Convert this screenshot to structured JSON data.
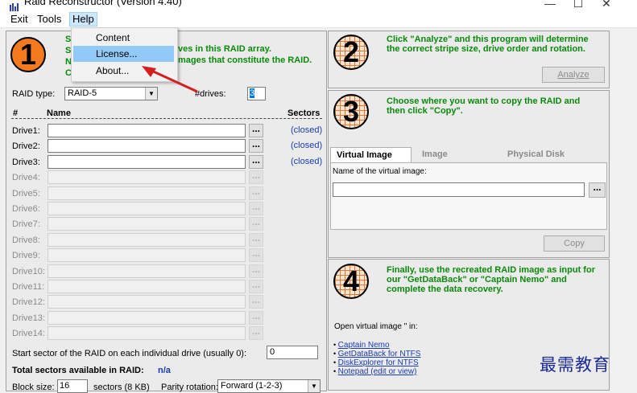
{
  "window": {
    "title": "Raid Reconstructor (Version 4.40)",
    "controls": [
      "—",
      "☐",
      "✕"
    ]
  },
  "menubar": {
    "items": [
      "Exit",
      "Tools",
      "Help"
    ]
  },
  "help_menu": {
    "items": [
      "Content",
      "License...",
      "About..."
    ],
    "highlighted": "License..."
  },
  "step1": {
    "number": "1",
    "line1_visible": "ves in this RAID array.",
    "line2_visible": "mages that constitute the RAID.",
    "left_fragments": [
      "S",
      "S",
      "N",
      "C"
    ],
    "raid_type_label": "RAID type:",
    "raid_type_value": "RAID-5",
    "drives_label": "#drives:",
    "drives_value": "3",
    "col_hash": "#",
    "col_name": "Name",
    "col_sectors": "Sectors",
    "drives": [
      {
        "label": "Drive1:",
        "status": "(closed)",
        "enabled": true
      },
      {
        "label": "Drive2:",
        "status": "(closed)",
        "enabled": true
      },
      {
        "label": "Drive3:",
        "status": "(closed)",
        "enabled": true
      },
      {
        "label": "Drive4:",
        "status": "",
        "enabled": false
      },
      {
        "label": "Drive5:",
        "status": "",
        "enabled": false
      },
      {
        "label": "Drive6:",
        "status": "",
        "enabled": false
      },
      {
        "label": "Drive7:",
        "status": "",
        "enabled": false
      },
      {
        "label": "Drive8:",
        "status": "",
        "enabled": false
      },
      {
        "label": "Drive9:",
        "status": "",
        "enabled": false
      },
      {
        "label": "Drive10:",
        "status": "",
        "enabled": false
      },
      {
        "label": "Drive11:",
        "status": "",
        "enabled": false
      },
      {
        "label": "Drive12:",
        "status": "",
        "enabled": false
      },
      {
        "label": "Drive13:",
        "status": "",
        "enabled": false
      },
      {
        "label": "Drive14:",
        "status": "",
        "enabled": false
      }
    ],
    "browse_label": "...",
    "start_sector_label": "Start sector of the RAID on each individual drive (usually 0):",
    "start_sector_value": "0",
    "total_label": "Total sectors available in RAID:",
    "total_value": "n/a",
    "block_size_label": "Block size:",
    "block_size_value": "16",
    "block_size_unit": "sectors (8 KB)",
    "parity_label": "Parity rotation:",
    "parity_value": "Forward (1-2-3)"
  },
  "step2": {
    "number": "2",
    "text": "Click \"Analyze\" and this program will determine the correct stripe size, drive order and rotation.",
    "button": "Analyze"
  },
  "step3": {
    "number": "3",
    "text": "Choose where you want to copy the RAID and then click \"Copy\".",
    "tabs": [
      "Virtual Image",
      "Image",
      "Physical Disk"
    ],
    "active_tab": "Virtual Image",
    "name_label": "Name of the virtual image:",
    "browse_label": "...",
    "button": "Copy"
  },
  "step4": {
    "number": "4",
    "text": "Finally, use the recreated RAID image as input for our \"GetDataBack\" or \"Captain Nemo\" and complete the data recovery.",
    "open_label": "Open virtual image \" in:",
    "links": [
      "Captain Nemo",
      "GetDataBack for NTFS",
      "DiskExplorer for NTFS",
      "Notepad (edit or view)"
    ]
  },
  "watermark": "最需教育",
  "colors": {
    "step_text": "#0a8a0a",
    "circle1_fill": "#f37a1f",
    "grid_circle": "#d87a3a",
    "link": "#1a3cb0",
    "arrow": "#d42020",
    "menu_highlight": "#cce8ff"
  }
}
